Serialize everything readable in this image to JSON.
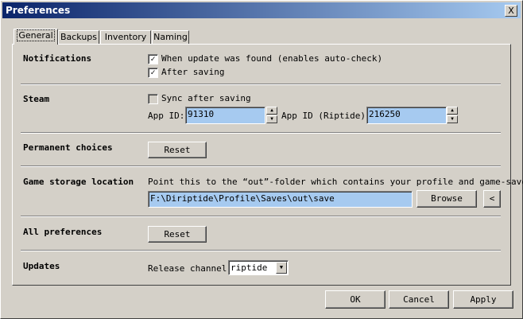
{
  "window": {
    "title": "Preferences",
    "close_glyph": "X"
  },
  "tabs": [
    {
      "label": "General"
    },
    {
      "label": "Backups"
    },
    {
      "label": "Inventory"
    },
    {
      "label": "Naming"
    }
  ],
  "notifications": {
    "heading": "Notifications",
    "update_found": {
      "label": "When update was found (enables auto-check)",
      "checked": true
    },
    "after_saving": {
      "label": "After saving",
      "checked": true
    }
  },
  "steam": {
    "heading": "Steam",
    "sync": {
      "label": "Sync after saving",
      "checked": false
    },
    "app_id_label": "App ID:",
    "app_id_value": "91310",
    "riptide_label": "App ID (Riptide):",
    "riptide_value": "216250"
  },
  "permanent_choices": {
    "heading": "Permanent choices",
    "reset_label": "Reset"
  },
  "game_storage": {
    "heading": "Game storage location",
    "hint": "Point this to the “out”-folder which contains your profile and game-saves.",
    "path": "F:\\Diriptide\\Profile\\Saves\\out\\save",
    "browse_label": "Browse",
    "back_label": "<"
  },
  "all_preferences": {
    "heading": "All preferences",
    "reset_label": "Reset"
  },
  "updates": {
    "heading": "Updates",
    "channel_label": "Release channel:",
    "channel_value": "riptide"
  },
  "footer": {
    "ok_label": "OK",
    "cancel_label": "Cancel",
    "apply_label": "Apply"
  }
}
